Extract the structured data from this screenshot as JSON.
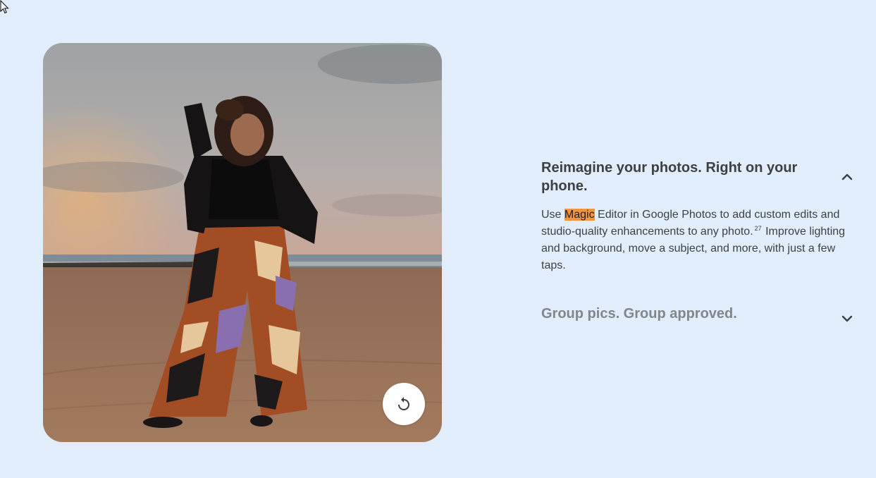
{
  "accordion": {
    "items": [
      {
        "title": "Reimagine your photos. Right on your phone.",
        "expanded": true,
        "body": {
          "text_before": "Use ",
          "highlight": "Magic",
          "text_middle": " Editor in Google Photos to add custom edits and studio-quality enhancements to any photo.",
          "footnote": "27",
          "text_after": " Improve lighting and background, move a subject, and more, with just a few taps."
        }
      },
      {
        "title": "Group pics. Group approved.",
        "expanded": false
      }
    ]
  },
  "photo": {
    "replay_icon": "replay-icon"
  },
  "colors": {
    "background": "#e2edfb",
    "highlight": "#f5943c",
    "title_active": "#3c4043",
    "title_inactive": "#80868b"
  }
}
